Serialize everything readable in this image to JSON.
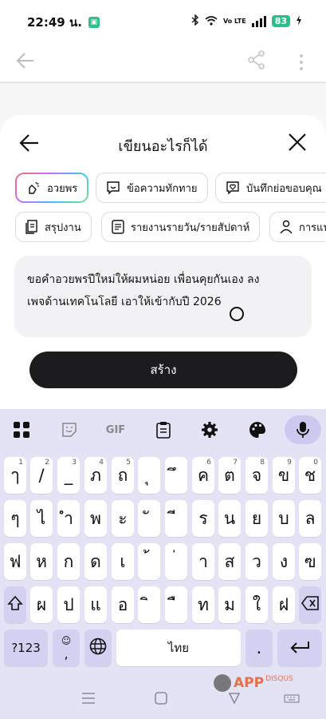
{
  "status_bar": {
    "time": "22:49 น.",
    "volte": "Vo LTE",
    "battery": "83"
  },
  "sheet": {
    "title": "เขียนอะไรก็ได้",
    "chips_row1": [
      "อวยพร",
      "ข้อความทักทาย",
      "บันทึกย่อขอบคุณ"
    ],
    "chips_row2": [
      "สรุปงาน",
      "รายงานรายวัน/รายสัปดาห์",
      "การแน"
    ],
    "prompt_line1": "ขอคำอวยพรปีใหม่ให้ผมหน่อย เพื่อนคุยกันเอง ลง",
    "prompt_line2": "เพจด้านเทคโนโลยี เอาให้เข้ากับปี 2026",
    "create_label": "สร้าง"
  },
  "keyboard": {
    "toolbar_gif": "GIF",
    "row1": [
      {
        "ch": "ๅ",
        "sup": "1"
      },
      {
        "ch": "/",
        "sup": "2"
      },
      {
        "ch": "_",
        "sup": "3"
      },
      {
        "ch": "ภ",
        "sup": "4"
      },
      {
        "ch": "ถ",
        "sup": "5"
      },
      {
        "ch": "ุ",
        "sup": ""
      },
      {
        "ch": "ึ",
        "sup": ""
      },
      {
        "ch": "ค",
        "sup": "6"
      },
      {
        "ch": "ต",
        "sup": "7"
      },
      {
        "ch": "จ",
        "sup": "8"
      },
      {
        "ch": "ข",
        "sup": "9"
      },
      {
        "ch": "ช",
        "sup": "0"
      }
    ],
    "row2": [
      "ๆ",
      "ไ",
      "ำ",
      "พ",
      "ะ",
      "ั",
      "ี",
      "ร",
      "น",
      "ย",
      "บ",
      "ล"
    ],
    "row3": [
      "ฟ",
      "ห",
      "ก",
      "ด",
      "เ",
      "้",
      "่",
      "า",
      "ส",
      "ว",
      "ง",
      "ฃ"
    ],
    "row4": [
      "ผ",
      "ป",
      "แ",
      "อ",
      "ิ",
      "ื",
      "ท",
      "ม",
      "ใ",
      "ฝ"
    ],
    "symbols_label": "?123",
    "comma": ",",
    "space_label": "ไทย",
    "period": "."
  },
  "watermark": {
    "app": "APP",
    "name": "DISQUS"
  }
}
